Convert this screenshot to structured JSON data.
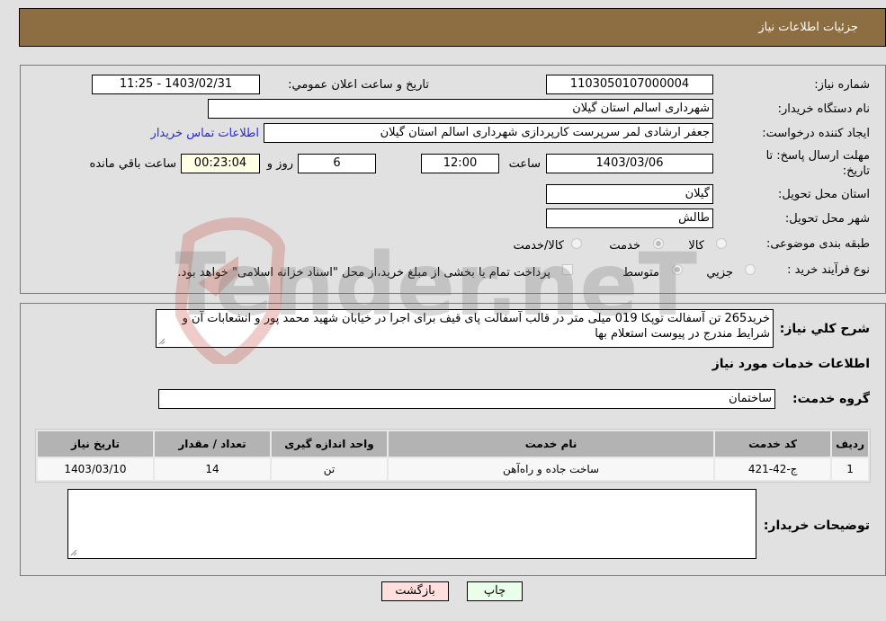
{
  "header": {
    "title": "جزئیات اطلاعات نیاز"
  },
  "fields": {
    "need_number": {
      "label": "شماره نیاز:",
      "value": "1103050107000004"
    },
    "announce_datetime": {
      "label": "تاریخ و ساعت اعلان عمومي:",
      "value": "1403/02/31 - 11:25"
    },
    "buyer_org": {
      "label": "نام دستگاه خریدار:",
      "value": "شهرداری اسالم استان گیلان"
    },
    "requester": {
      "label": "ایجاد کننده درخواست:",
      "value": "جعفر ارشادی لمر سرپرست کارپردازی شهرداری اسالم استان گیلان"
    },
    "contact_link": "اطلاعات تماس خریدار",
    "deadline": {
      "label": "مهلت ارسال پاسخ: تا تاریخ:",
      "date": "1403/03/06",
      "time_label": "ساعت",
      "time": "12:00",
      "days": "6",
      "days_label": "روز و",
      "remaining": "00:23:04",
      "remaining_label": "ساعت باقي مانده"
    },
    "province": {
      "label": "استان محل تحویل:",
      "value": "گیلان"
    },
    "city": {
      "label": "شهر محل تحویل:",
      "value": "طالش"
    },
    "category": {
      "label": "طبقه بندی موضوعی:",
      "options": [
        "کالا",
        "خدمت",
        "کالا/خدمت"
      ],
      "selected": "خدمت"
    },
    "purchase_type": {
      "label": "نوع فرآیند خرید :",
      "options": [
        "جزيي",
        "متوسط"
      ],
      "selected": "متوسط",
      "treasury_note": "پرداخت تمام یا بخشی از مبلغ خرید،از محل \"اسناد خزانه اسلامی\" خواهد بود."
    }
  },
  "description": {
    "label": "شرح کلي نیاز:",
    "value": "خرید265 تن آسفالت توپکا 019 میلی متر در قالب آسفالت پای قیف برای اجرا در خیابان شهید محمد پور و انشعابات آن و شرایط مندرج در پیوست استعلام بها"
  },
  "services_section": {
    "title": "اطلاعات خدمات مورد نیاز",
    "group_label": "گروه خدمت:",
    "group_value": "ساختمان",
    "table": {
      "headers": [
        "ردیف",
        "کد خدمت",
        "نام خدمت",
        "واحد اندازه گیری",
        "تعداد / مقدار",
        "تاریخ نیاز"
      ],
      "rows": [
        [
          "1",
          "ج-42-421",
          "ساخت جاده و راه‌آهن",
          "تن",
          "14",
          "1403/03/10"
        ]
      ]
    }
  },
  "buyer_notes": {
    "label": "توضیحات خریدار:",
    "value": ""
  },
  "buttons": {
    "print": "چاپ",
    "back": "بازگشت"
  },
  "watermark": "AriaTender.neT",
  "colors": {
    "header_bg": "#8d6d42",
    "print_bg": "#eaffea",
    "back_bg": "#ffdede",
    "link": "#2a2ad0"
  }
}
